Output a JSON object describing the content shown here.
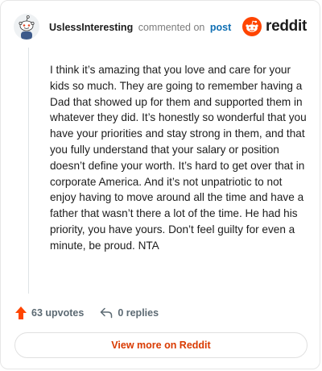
{
  "header": {
    "username": "UslessInteresting",
    "action": "commented on",
    "post_link": "post",
    "brand": "reddit",
    "brand_color": "#ff4500"
  },
  "comment": {
    "text": "I think it’s amazing that you love and care for your kids so much. They are going to remember having a Dad that showed up for them and supported them in whatever they did. It’s honestly so wonderful that you have your priorities and stay strong in them, and that you fully understand that your salary or position doesn’t define your worth. It’s hard to get over that in corporate America. And it’s not unpatriotic to not enjoy having to move around all the time and have a father that wasn’t there a lot of the time. He had his priority, you have yours. Don’t feel guilty for even a minute, be proud. NTA"
  },
  "footer": {
    "upvotes": "63 upvotes",
    "upvote_icon": "upvote-arrow-icon",
    "replies": "0 replies",
    "reply_icon": "reply-arrow-icon"
  },
  "actions": {
    "view_more": "View more on Reddit",
    "accent_color": "#d93a00"
  }
}
